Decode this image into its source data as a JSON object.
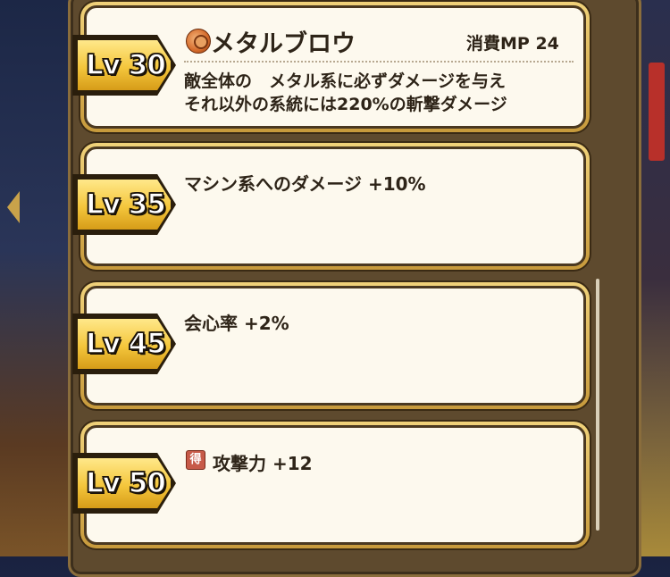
{
  "skills": [
    {
      "level": "Lv 30",
      "name": "メタルブロウ",
      "mp": "消費MP 24",
      "desc_line1": "敵全体の　メタル系に必ずダメージを与え",
      "desc_line2": "それ以外の系統には220%の斬撃ダメージ"
    },
    {
      "level": "Lv 35",
      "text": "マシン系へのダメージ +10%"
    },
    {
      "level": "Lv 45",
      "text": "会心率 +2%"
    },
    {
      "level": "Lv 50",
      "icon_label": "得",
      "text": "攻撃力 +12"
    }
  ],
  "colors": {
    "badge_gold": "#f4c63c",
    "card_bg": "#fdf9ee",
    "panel_brown": "#5e4a2e",
    "text": "#2e2418"
  },
  "icons": {
    "skill_icon": "orange-orb-icon",
    "tokusei_icon": "toku-icon"
  }
}
